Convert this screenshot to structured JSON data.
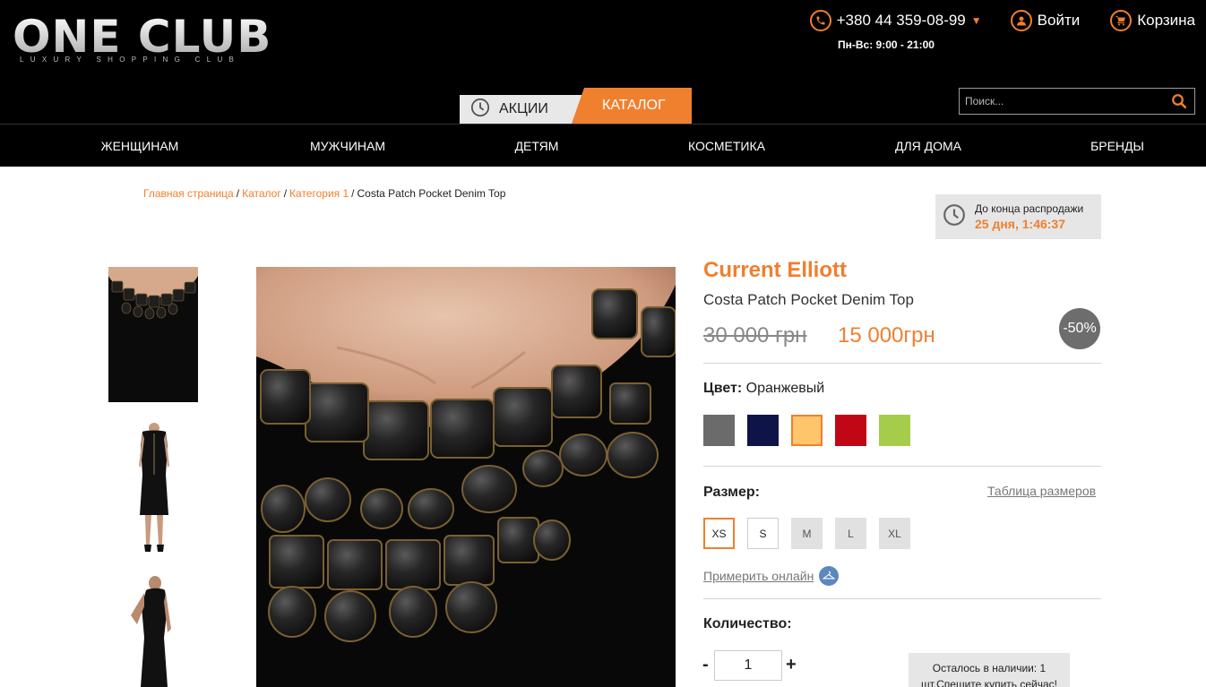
{
  "header": {
    "logo_main": "ONE CLUB",
    "logo_sub": "LUXURY SHOPPING CLUB",
    "phone": "+380 44 359-08-99",
    "hours": "Пн-Вс: 9:00 - 21:00",
    "login": "Войти",
    "cart": "Корзина",
    "accent_color": "#f07f2e",
    "tabs": [
      {
        "label": "АКЦИИ",
        "icon": "clock-icon"
      },
      {
        "label": "КАТАЛОГ"
      }
    ],
    "search_placeholder": "Поиск..."
  },
  "nav": {
    "items": [
      "ЖЕНЩИНАМ",
      "МУЖЧИНАМ",
      "ДЕТЯМ",
      "КОСМЕТИКА",
      "ДЛЯ ДОМА",
      "БРЕНДЫ"
    ]
  },
  "breadcrumb": {
    "home": "Главная страница",
    "catalog": "Каталог",
    "category": "Категория 1",
    "current": "Costa Patch Pocket Denim Top"
  },
  "sale": {
    "label": "До конца распродажи",
    "time": "25 дня, 1:46:37"
  },
  "product": {
    "brand": "Current Elliott",
    "name": "Costa Patch Pocket Denim Top",
    "old_price": "30 000 грн",
    "new_price": "15 000грн",
    "discount": "-50%",
    "color_label": "Цвет:",
    "color_value": "Оранжевый",
    "colors": [
      "#6b6b6b",
      "#0f1448",
      "#ffc56b",
      "#c10716",
      "#a5cd4b"
    ],
    "selected_color_index": 2,
    "size_label": "Размер:",
    "size_table": "Таблица размеров",
    "sizes": [
      "XS",
      "S",
      "M",
      "L",
      "XL"
    ],
    "selected_size": "XS",
    "try_on": "Примерить онлайн",
    "quantity_label": "Количество:",
    "quantity": "1",
    "minus": "-",
    "plus": "+",
    "stock_line1": "Осталось в наличии: 1",
    "stock_line2": "шт.Спешите купить сейчас!"
  }
}
